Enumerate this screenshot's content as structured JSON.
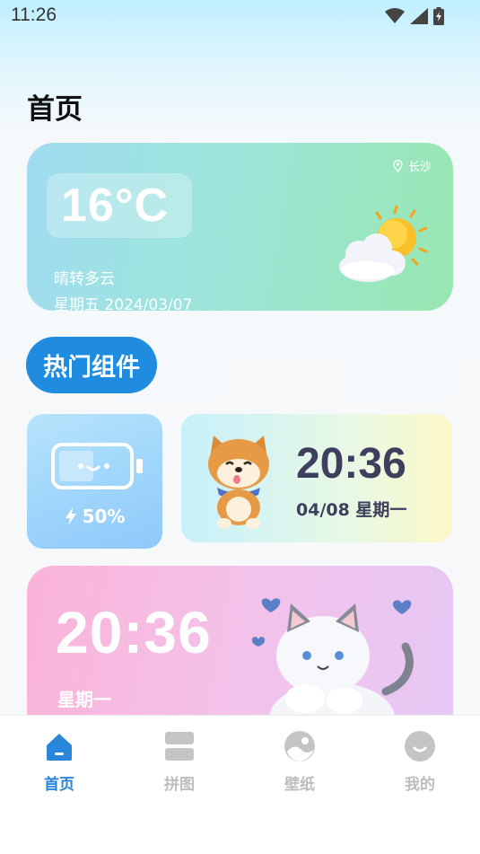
{
  "status_bar": {
    "time": "11:26"
  },
  "page": {
    "title": "首页"
  },
  "weather": {
    "temperature": "16°C",
    "description": "晴转多云",
    "date": "星期五 2024/03/07",
    "location": "长沙"
  },
  "section": {
    "hot_widgets_label": "热门组件"
  },
  "battery_widget": {
    "percent_text": "50%",
    "level": 0.5
  },
  "shiba_widget": {
    "time": "20:36",
    "date": "04/08  星期一"
  },
  "cat_widget": {
    "time": "20:36",
    "weekday": "星期一"
  },
  "tabs": [
    {
      "label": "首页",
      "icon": "home-icon",
      "active": true
    },
    {
      "label": "拼图",
      "icon": "puzzle-icon",
      "active": false
    },
    {
      "label": "壁纸",
      "icon": "wallpaper-icon",
      "active": false
    },
    {
      "label": "我的",
      "icon": "profile-icon",
      "active": false
    }
  ],
  "colors": {
    "accent": "#2a86d8",
    "inactive": "#bdbdbd"
  }
}
